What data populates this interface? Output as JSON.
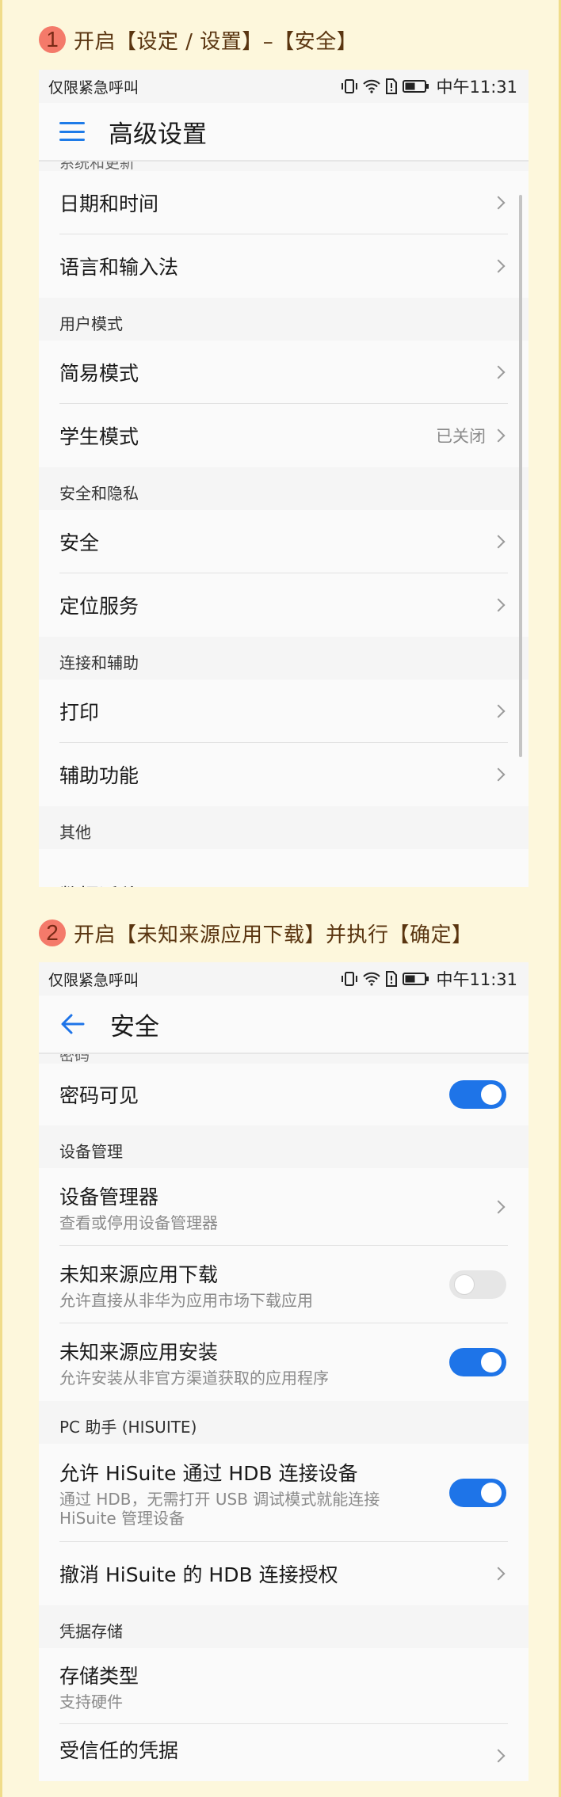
{
  "steps": [
    {
      "num": "1",
      "text": "开启【设定 / 设置】–【安全】"
    },
    {
      "num": "2",
      "text": "开启【未知来源应用下载】并执行【确定】"
    }
  ],
  "statusbar": {
    "left": "仅限紧急呼叫",
    "time": "中午11:31"
  },
  "screen1": {
    "title": "高级设置",
    "top_cut_label": "系统和更新",
    "rows": {
      "date_time": "日期和时间",
      "language": "语言和输入法",
      "section_user": "用户模式",
      "simple_mode": "简易模式",
      "student_mode": "学生模式",
      "student_status": "已关闭",
      "section_security": "安全和隐私",
      "security": "安全",
      "location": "定位服务",
      "section_connect": "连接和辅助",
      "print": "打印",
      "accessibility": "辅助功能",
      "section_other": "其他",
      "data_migration": "数据迁移"
    }
  },
  "screen2": {
    "title": "安全",
    "top_cut_label": "密码",
    "rows": {
      "password_visible": "密码可见",
      "section_device": "设备管理",
      "device_admin": "设备管理器",
      "device_admin_sub": "查看或停用设备管理器",
      "unknown_download": "未知来源应用下载",
      "unknown_download_sub": "允许直接从非华为应用市场下载应用",
      "unknown_install": "未知来源应用安装",
      "unknown_install_sub": "允许安装从非官方渠道获取的应用程序",
      "section_pc": "PC 助手 (HISUITE)",
      "hisuite_allow": "允许 HiSuite 通过 HDB 连接设备",
      "hisuite_allow_sub": "通过 HDB，无需打开 USB 调试模式就能连接 HiSuite 管理设备",
      "hisuite_revoke": "撤消 HiSuite 的 HDB 连接授权",
      "section_credential": "凭据存储",
      "storage_type": "存储类型",
      "storage_type_sub": "支持硬件",
      "trusted_credentials": "受信任的凭据"
    },
    "toggles": {
      "password_visible": true,
      "unknown_download": false,
      "unknown_install": true,
      "hisuite_allow": true
    }
  },
  "colors": {
    "accent": "#1e74e8",
    "step_badge": "#f47a6a",
    "page_bg": "#fdf7dc"
  },
  "icons": [
    "menu-icon",
    "back-icon",
    "vibrate-icon",
    "wifi-icon",
    "sim-icon",
    "battery-icon",
    "chevron-right-icon"
  ]
}
